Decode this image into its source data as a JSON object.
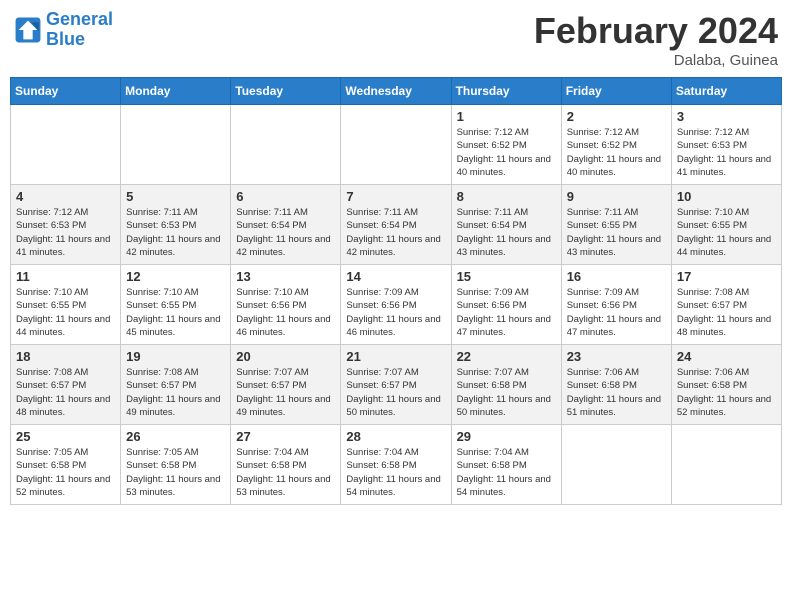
{
  "header": {
    "logo_line1": "General",
    "logo_line2": "Blue",
    "month": "February 2024",
    "location": "Dalaba, Guinea"
  },
  "days_of_week": [
    "Sunday",
    "Monday",
    "Tuesday",
    "Wednesday",
    "Thursday",
    "Friday",
    "Saturday"
  ],
  "weeks": [
    [
      {
        "day": "",
        "info": ""
      },
      {
        "day": "",
        "info": ""
      },
      {
        "day": "",
        "info": ""
      },
      {
        "day": "",
        "info": ""
      },
      {
        "day": "1",
        "info": "Sunrise: 7:12 AM\nSunset: 6:52 PM\nDaylight: 11 hours\nand 40 minutes."
      },
      {
        "day": "2",
        "info": "Sunrise: 7:12 AM\nSunset: 6:52 PM\nDaylight: 11 hours\nand 40 minutes."
      },
      {
        "day": "3",
        "info": "Sunrise: 7:12 AM\nSunset: 6:53 PM\nDaylight: 11 hours\nand 41 minutes."
      }
    ],
    [
      {
        "day": "4",
        "info": "Sunrise: 7:12 AM\nSunset: 6:53 PM\nDaylight: 11 hours\nand 41 minutes."
      },
      {
        "day": "5",
        "info": "Sunrise: 7:11 AM\nSunset: 6:53 PM\nDaylight: 11 hours\nand 42 minutes."
      },
      {
        "day": "6",
        "info": "Sunrise: 7:11 AM\nSunset: 6:54 PM\nDaylight: 11 hours\nand 42 minutes."
      },
      {
        "day": "7",
        "info": "Sunrise: 7:11 AM\nSunset: 6:54 PM\nDaylight: 11 hours\nand 42 minutes."
      },
      {
        "day": "8",
        "info": "Sunrise: 7:11 AM\nSunset: 6:54 PM\nDaylight: 11 hours\nand 43 minutes."
      },
      {
        "day": "9",
        "info": "Sunrise: 7:11 AM\nSunset: 6:55 PM\nDaylight: 11 hours\nand 43 minutes."
      },
      {
        "day": "10",
        "info": "Sunrise: 7:10 AM\nSunset: 6:55 PM\nDaylight: 11 hours\nand 44 minutes."
      }
    ],
    [
      {
        "day": "11",
        "info": "Sunrise: 7:10 AM\nSunset: 6:55 PM\nDaylight: 11 hours\nand 44 minutes."
      },
      {
        "day": "12",
        "info": "Sunrise: 7:10 AM\nSunset: 6:55 PM\nDaylight: 11 hours\nand 45 minutes."
      },
      {
        "day": "13",
        "info": "Sunrise: 7:10 AM\nSunset: 6:56 PM\nDaylight: 11 hours\nand 46 minutes."
      },
      {
        "day": "14",
        "info": "Sunrise: 7:09 AM\nSunset: 6:56 PM\nDaylight: 11 hours\nand 46 minutes."
      },
      {
        "day": "15",
        "info": "Sunrise: 7:09 AM\nSunset: 6:56 PM\nDaylight: 11 hours\nand 47 minutes."
      },
      {
        "day": "16",
        "info": "Sunrise: 7:09 AM\nSunset: 6:56 PM\nDaylight: 11 hours\nand 47 minutes."
      },
      {
        "day": "17",
        "info": "Sunrise: 7:08 AM\nSunset: 6:57 PM\nDaylight: 11 hours\nand 48 minutes."
      }
    ],
    [
      {
        "day": "18",
        "info": "Sunrise: 7:08 AM\nSunset: 6:57 PM\nDaylight: 11 hours\nand 48 minutes."
      },
      {
        "day": "19",
        "info": "Sunrise: 7:08 AM\nSunset: 6:57 PM\nDaylight: 11 hours\nand 49 minutes."
      },
      {
        "day": "20",
        "info": "Sunrise: 7:07 AM\nSunset: 6:57 PM\nDaylight: 11 hours\nand 49 minutes."
      },
      {
        "day": "21",
        "info": "Sunrise: 7:07 AM\nSunset: 6:57 PM\nDaylight: 11 hours\nand 50 minutes."
      },
      {
        "day": "22",
        "info": "Sunrise: 7:07 AM\nSunset: 6:58 PM\nDaylight: 11 hours\nand 50 minutes."
      },
      {
        "day": "23",
        "info": "Sunrise: 7:06 AM\nSunset: 6:58 PM\nDaylight: 11 hours\nand 51 minutes."
      },
      {
        "day": "24",
        "info": "Sunrise: 7:06 AM\nSunset: 6:58 PM\nDaylight: 11 hours\nand 52 minutes."
      }
    ],
    [
      {
        "day": "25",
        "info": "Sunrise: 7:05 AM\nSunset: 6:58 PM\nDaylight: 11 hours\nand 52 minutes."
      },
      {
        "day": "26",
        "info": "Sunrise: 7:05 AM\nSunset: 6:58 PM\nDaylight: 11 hours\nand 53 minutes."
      },
      {
        "day": "27",
        "info": "Sunrise: 7:04 AM\nSunset: 6:58 PM\nDaylight: 11 hours\nand 53 minutes."
      },
      {
        "day": "28",
        "info": "Sunrise: 7:04 AM\nSunset: 6:58 PM\nDaylight: 11 hours\nand 54 minutes."
      },
      {
        "day": "29",
        "info": "Sunrise: 7:04 AM\nSunset: 6:58 PM\nDaylight: 11 hours\nand 54 minutes."
      },
      {
        "day": "",
        "info": ""
      },
      {
        "day": "",
        "info": ""
      }
    ]
  ]
}
